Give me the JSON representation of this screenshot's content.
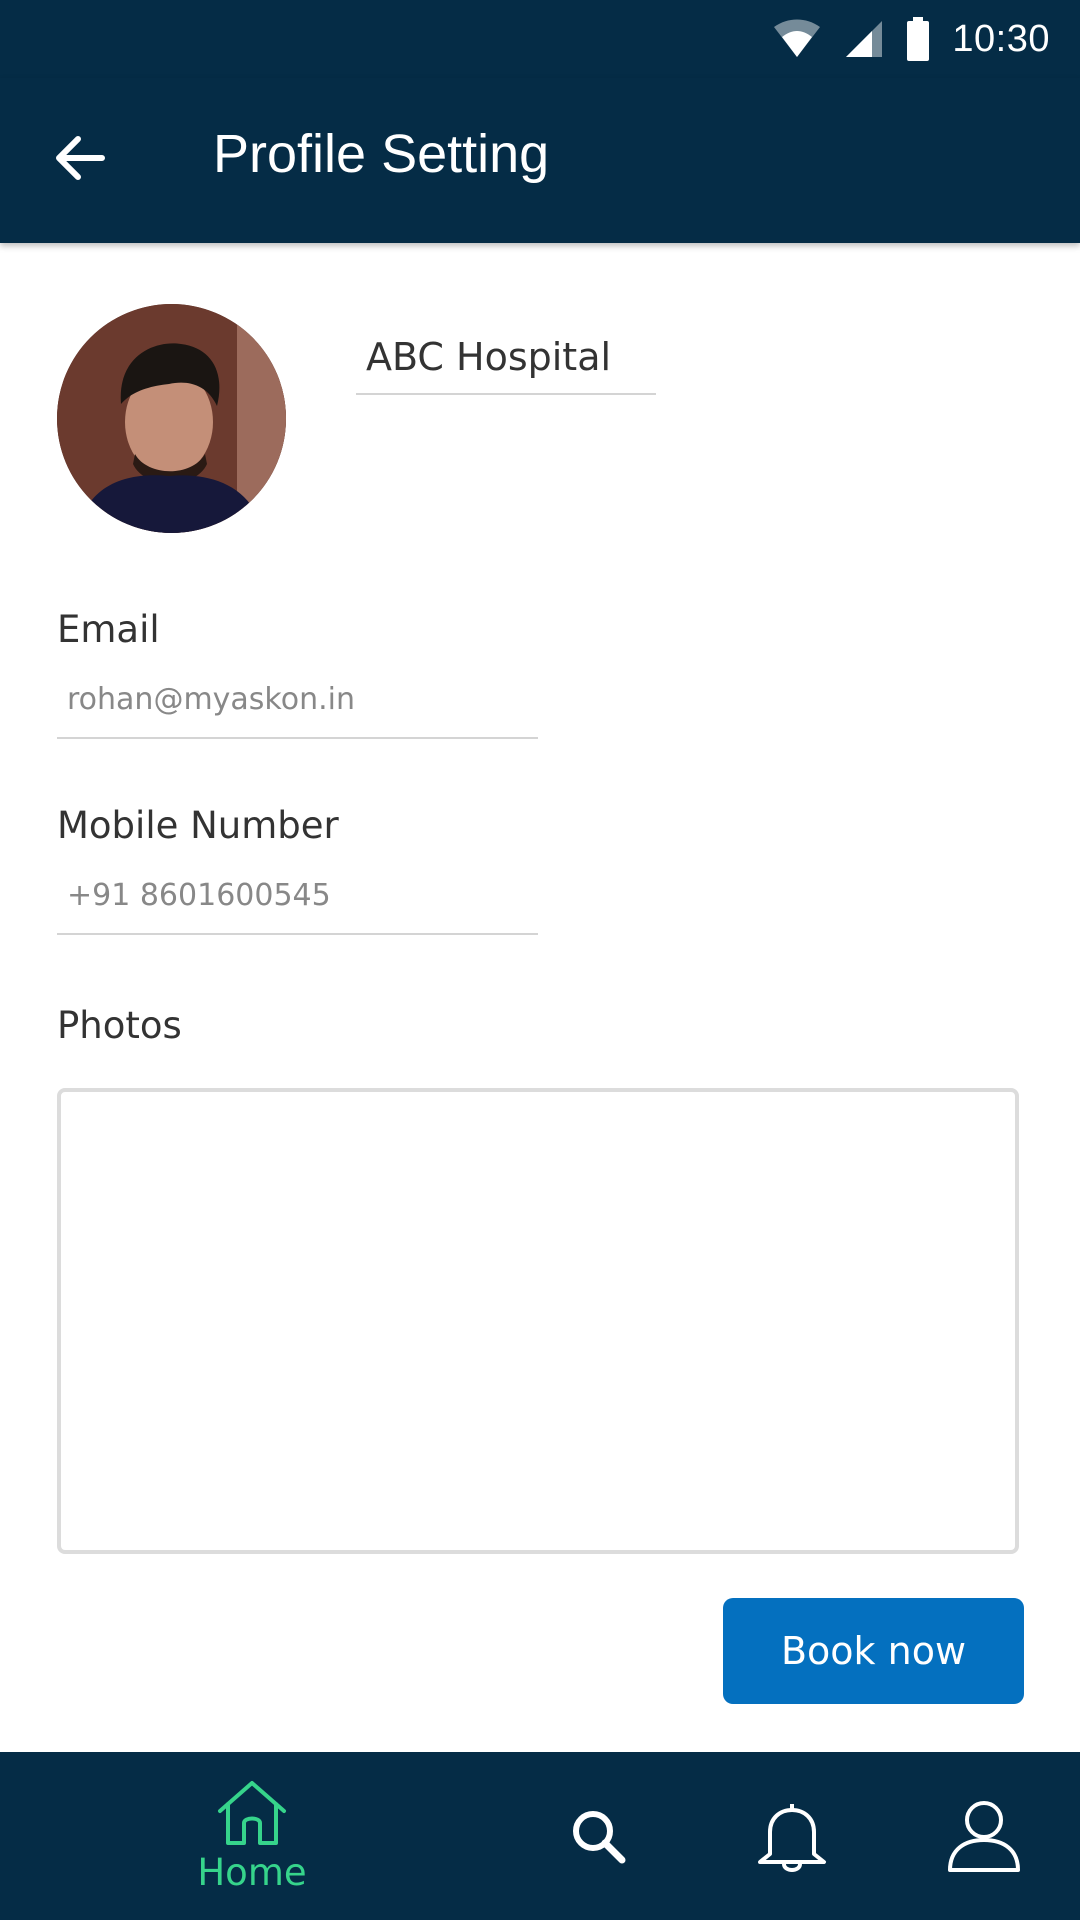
{
  "status_bar": {
    "time": "10:30",
    "icons": [
      "wifi-icon",
      "cellular-signal-icon",
      "battery-icon"
    ]
  },
  "app_bar": {
    "title": "Profile Setting",
    "back_icon": "arrow-left-icon"
  },
  "profile": {
    "name": "ABC Hospital",
    "avatar": "profile-photo"
  },
  "form": {
    "email_label": "Email",
    "email_value": "rohan@myaskon.in",
    "mobile_label": "Mobile Number",
    "mobile_value": "+91 8601600545",
    "photos_label": "Photos"
  },
  "actions": {
    "book_label": "Book now"
  },
  "bottom_nav": {
    "items": [
      {
        "icon": "home-icon",
        "label": "Home",
        "active": true
      },
      {
        "icon": "search-icon"
      },
      {
        "icon": "bell-icon"
      },
      {
        "icon": "user-icon"
      }
    ]
  },
  "colors": {
    "primary_dark": "#052c46",
    "accent_blue": "#0470bf",
    "active_green": "#36d48b"
  }
}
